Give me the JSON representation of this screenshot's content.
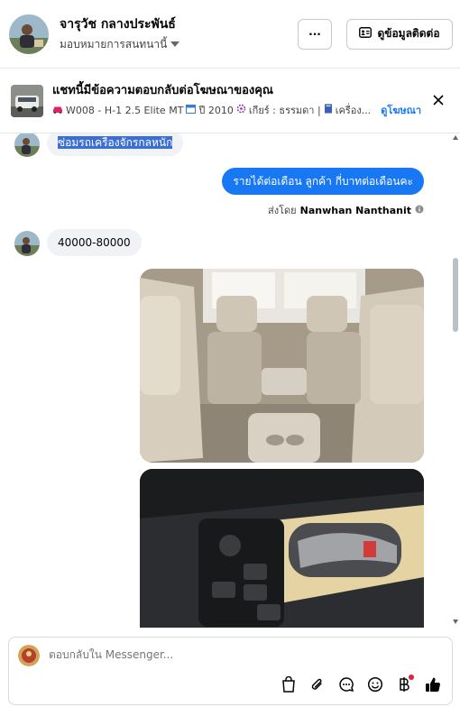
{
  "header": {
    "name": "จารุวัช กลางประพันธ์",
    "assign_label": "มอบหมายการสนทนานี้",
    "more_label": "···",
    "contact_label": "ดูข้อมูลติดต่อ"
  },
  "ad": {
    "title": "แชทนี้มีข้อความตอบกลับต่อโฆษณาของคุณ",
    "code": "W008 - H-1 2.5 Elite MT",
    "year": "ปี 2010",
    "gear": "เกียร์ : ธรรมดา |",
    "engine": "เครื่อง...",
    "link": "ดูโฆษณา"
  },
  "messages": {
    "incoming_1": "ซ่อมรถเครื่องจักรกลหนัก",
    "outgoing_1": "รายได้ต่อเดือน  ลูกค้า กี่บาทต่อเดือนคะ",
    "sent_by_prefix": "ส่งโดย",
    "sent_by_name": "Nanwhan Nanthanit",
    "incoming_2": "40000-80000"
  },
  "composer": {
    "placeholder": "ตอบกลับใน Messenger..."
  },
  "colors": {
    "accent": "#1877f2",
    "bubble_in": "#f0f2f5",
    "notify_dot": "#e41e3f"
  }
}
